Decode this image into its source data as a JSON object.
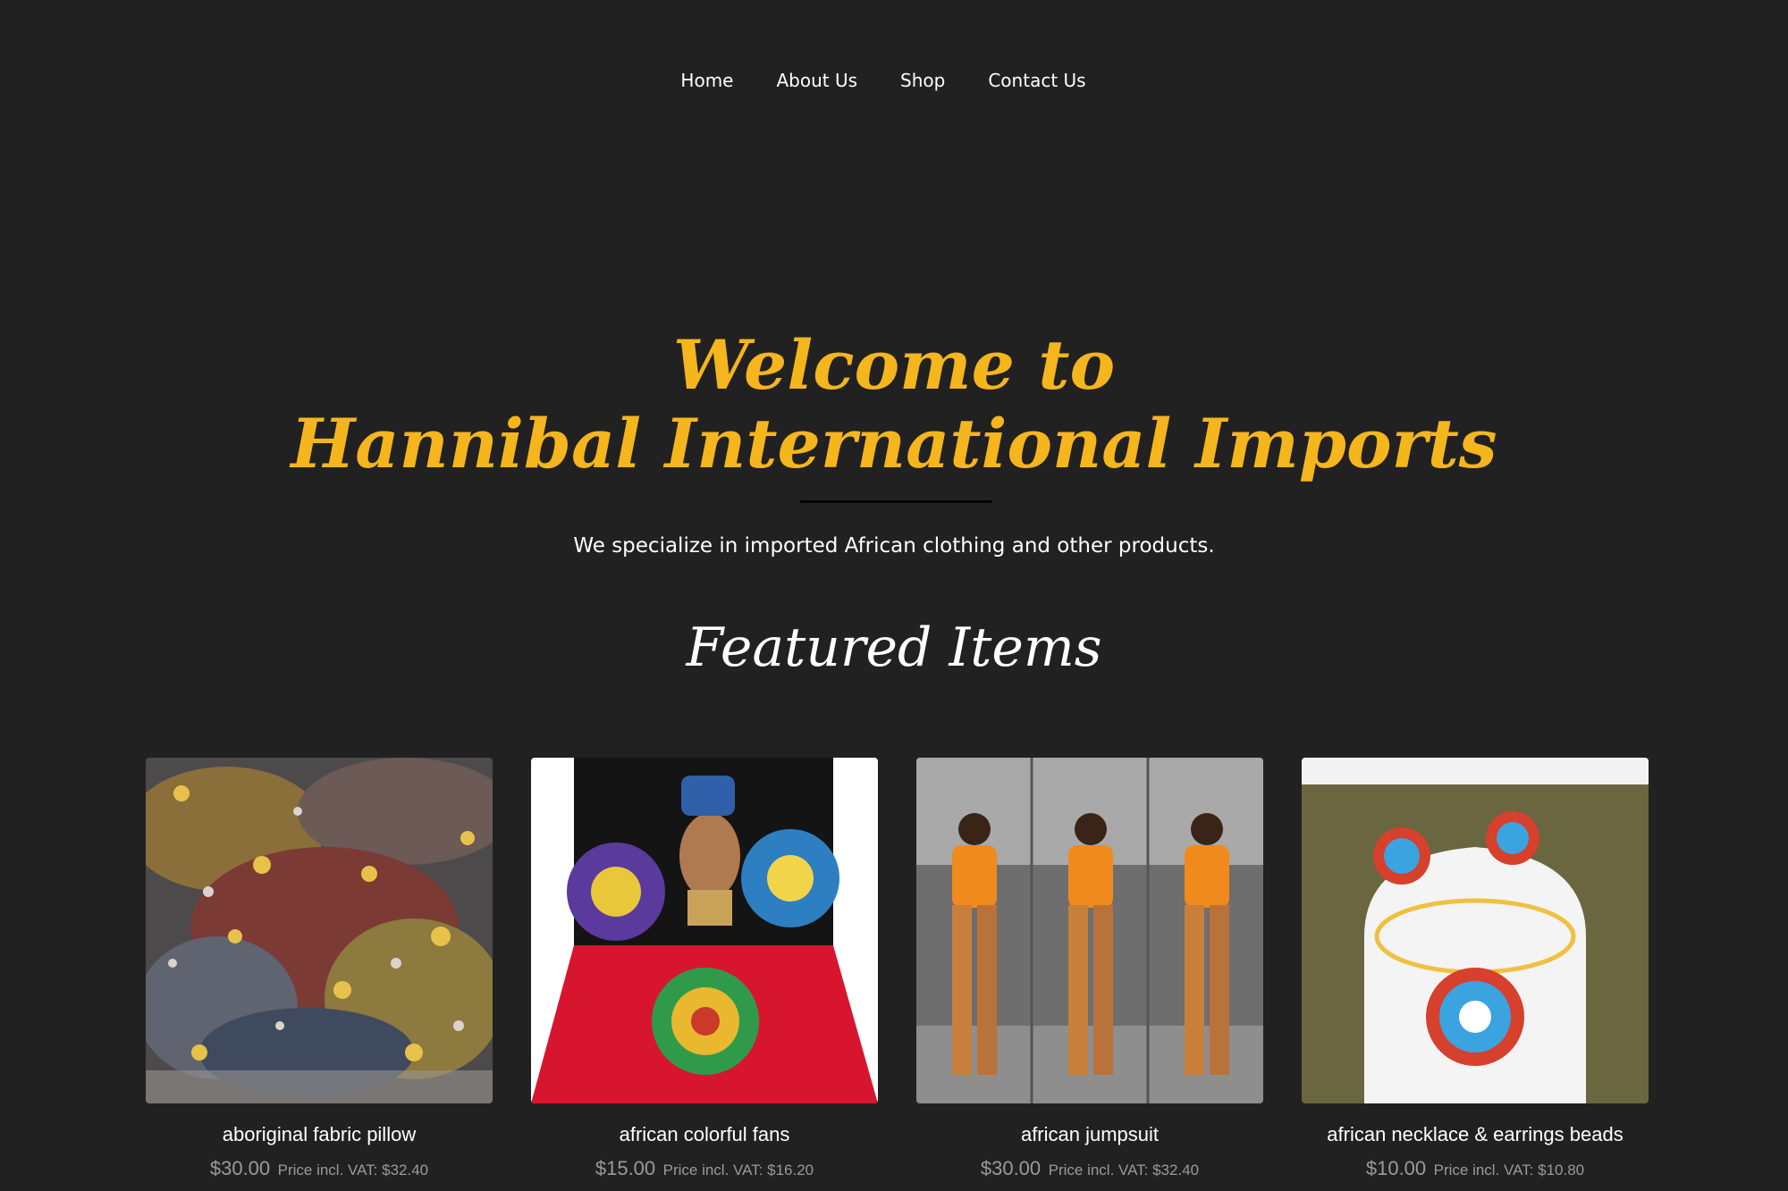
{
  "nav": {
    "items": [
      {
        "label": "Home"
      },
      {
        "label": "About Us"
      },
      {
        "label": "Shop"
      },
      {
        "label": "Contact Us"
      }
    ]
  },
  "hero": {
    "title_line1": "Welcome to",
    "title_line2": "Hannibal International Imports",
    "tagline": "We specialize in imported African clothing and other products."
  },
  "featured": {
    "heading": "Featured Items",
    "products": [
      {
        "name": "aboriginal fabric pillow",
        "price": "$30.00",
        "vat_label": "Price incl. VAT: $32.40",
        "image": "patterned-fabric-pillow"
      },
      {
        "name": "african colorful fans",
        "price": "$15.00",
        "vat_label": "Price incl. VAT: $16.20",
        "image": "colorful-hand-fans"
      },
      {
        "name": "african jumpsuit",
        "price": "$30.00",
        "vat_label": "Price incl. VAT: $32.40",
        "image": "orange-plaid-jumpsuit"
      },
      {
        "name": "african necklace & earrings beads",
        "price": "$10.00",
        "vat_label": "Price incl. VAT: $10.80",
        "image": "beaded-necklace-earrings"
      }
    ]
  },
  "colors": {
    "background": "#212121",
    "accent": "#f5b51d",
    "text": "#ffffff",
    "price": "#9a9a9a"
  }
}
